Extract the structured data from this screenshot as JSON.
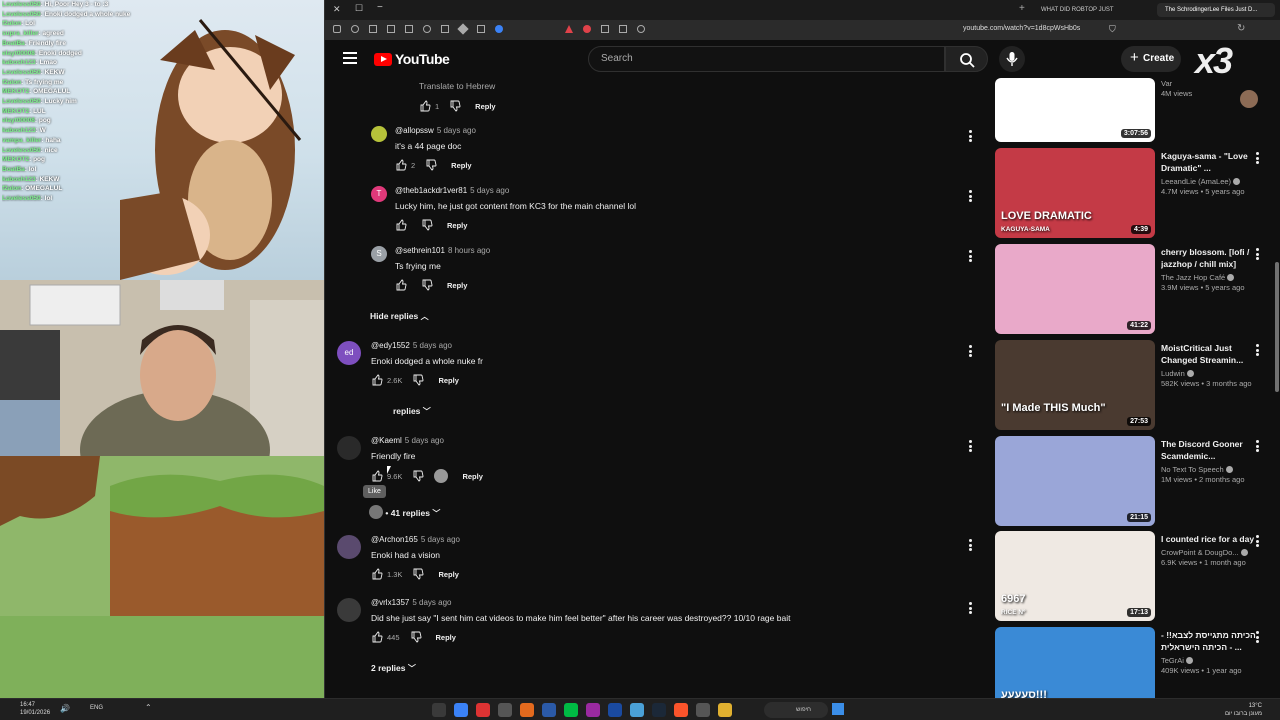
{
  "stream": {
    "chat": [
      {
        "user": "Loveless050",
        "msg": "Hi, Poor Hey 3 - to :3"
      },
      {
        "user": "Loveless050",
        "msg": "Enoki dodged a whole nuke"
      },
      {
        "user": "f2alon",
        "msg": "Lol"
      },
      {
        "user": "supra_killer",
        "msg": "agreed"
      },
      {
        "user": "BoatBa",
        "msg": "Friendly fire"
      },
      {
        "user": "elayt00008",
        "msg": "Enoki dodged"
      },
      {
        "user": "kabosh123",
        "msg": "Lmao"
      },
      {
        "user": "Loveless050",
        "msg": "KEKW"
      },
      {
        "user": "f2alon",
        "msg": "Ts frying me"
      },
      {
        "user": "MEKOT2",
        "msg": "OMEGALUL"
      },
      {
        "user": "Loveless050",
        "msg": "Lucky him"
      },
      {
        "user": "MEKOT2",
        "msg": "LUL"
      },
      {
        "user": "elayt00008",
        "msg": "pog"
      },
      {
        "user": "kabosh123",
        "msg": "W"
      },
      {
        "user": "vampa_killer",
        "msg": "haha"
      },
      {
        "user": "Loveless050",
        "msg": "nice"
      },
      {
        "user": "MEKOT2",
        "msg": "pog"
      },
      {
        "user": "BoatBa",
        "msg": "lol"
      },
      {
        "user": "kabosh123",
        "msg": "KEKW"
      },
      {
        "user": "f2alon",
        "msg": "OMEGALUL"
      },
      {
        "user": "Loveless050",
        "msg": "lol"
      }
    ]
  },
  "taskbar": {
    "clock": "16:47",
    "date": "19/01/2026",
    "lang": "ENG",
    "search": "חיפוש",
    "weather": "13°C",
    "weather_sub": "מעונן ברובו יום"
  },
  "browser": {
    "tabs": [
      "WHAT DID ROBTOP JUST RATE???",
      "The SchrodingerLee Files Just D..."
    ],
    "url": "youtube.com/watch?v=1d8cpWsHb0s"
  },
  "yt": {
    "logo": "YouTube",
    "search_placeholder": "Search",
    "create": "Create",
    "badge": "x3"
  },
  "comments": {
    "translate": "Translate to Hebrew",
    "items": [
      {
        "author": "@allopssw",
        "time": "5 days ago",
        "text": "it's a 44 page doc",
        "likes": "2",
        "reply": "Reply",
        "avatar": "#b6c23a"
      },
      {
        "author": "@theb1ackdr1ver81",
        "time": "5 days ago",
        "text": "Lucky him, he just got content from KC3 for the main channel lol",
        "likes": "",
        "reply": "Reply",
        "avatar": "#e0397a",
        "initial": "T"
      },
      {
        "author": "@sethrein101",
        "time": "8 hours ago",
        "text": "Ts frying me",
        "likes": "",
        "reply": "Reply",
        "avatar": "#9aa0a6",
        "initial": "S"
      },
      {
        "author": "@edy1552",
        "time": "5 days ago",
        "text": "Enoki dodged a whole nuke fr",
        "likes": "2.6K",
        "reply": "Reply",
        "avatar": "#7e4fbf",
        "initial": "ed"
      },
      {
        "author": "@Kaeml",
        "time": "5 days ago",
        "text": "Friendly fire",
        "likes": "9.6K",
        "reply": "Reply",
        "avatar": "#2a2a2a"
      },
      {
        "author": "@Archon165",
        "time": "5 days ago",
        "text": "Enoki had a vision",
        "likes": "1.3K",
        "reply": "Reply",
        "avatar": "#5a4a6e"
      },
      {
        "author": "@vrlx1357",
        "time": "5 days ago",
        "text": "Did she just say \"I sent him cat videos to make him feel better\" after his career was destroyed?? 10/10 rage bait",
        "likes": "445",
        "reply": "Reply",
        "avatar": "#3a3a3a"
      }
    ],
    "hide_replies": "Hide replies",
    "replies_edy": "replies",
    "replies_kaeml": "41 replies",
    "replies_vrlx": "2 replies",
    "tooltip": "Like",
    "top_reply_likes": "1",
    "top_reply": "Reply"
  },
  "sidebar": {
    "videos": [
      {
        "title": "",
        "channel": "Var",
        "meta": "4M views",
        "duration": "3:07:56",
        "thumb_title": "",
        "thumb_sub": "",
        "bg": "#ffffff"
      },
      {
        "title": "Kaguya-sama - \"Love Dramatic\" ...",
        "channel": "LeeandLie (AmaLee)",
        "meta": "4.7M views • 5 years ago",
        "duration": "4:39",
        "thumb_title": "LOVE DRAMATIC",
        "thumb_sub": "KAGUYA-SAMA",
        "bg": "#c43a46"
      },
      {
        "title": "cherry blossom. [lofi / jazzhop / chill mix]",
        "channel": "The Jazz Hop Café",
        "meta": "3.9M views • 5 years ago",
        "duration": "41:22",
        "thumb_title": "",
        "thumb_sub": "",
        "bg": "#e9a9c9"
      },
      {
        "title": "MoistCritical Just Changed Streamin...",
        "channel": "Ludwin",
        "meta": "582K views • 3 months ago",
        "duration": "27:53",
        "thumb_title": "\"I Made THIS Much\"",
        "thumb_sub": "",
        "bg": "#4a3a30"
      },
      {
        "title": "The Discord Gooner Scamdemic...",
        "channel": "No Text To Speech",
        "meta": "1M views • 2 months ago",
        "duration": "21:15",
        "thumb_title": "",
        "thumb_sub": "",
        "bg": "#9aa6d8"
      },
      {
        "title": "I counted rice for a day",
        "channel": "CrowPoint & DougDo...",
        "meta": "6.9K views • 1 month ago",
        "duration": "17:13",
        "thumb_title": "6967",
        "thumb_sub": "RICE Nº",
        "bg": "#efe9e3"
      },
      {
        "title": "הכיתה מתגייסת לצבא!! - הכיתה הישראלית - ...",
        "channel": "TeGrAi",
        "meta": "409K views • 1 year ago",
        "duration": "",
        "thumb_title": "סעעעע!!!",
        "thumb_sub": "",
        "bg": "#3a8ad6"
      }
    ]
  }
}
